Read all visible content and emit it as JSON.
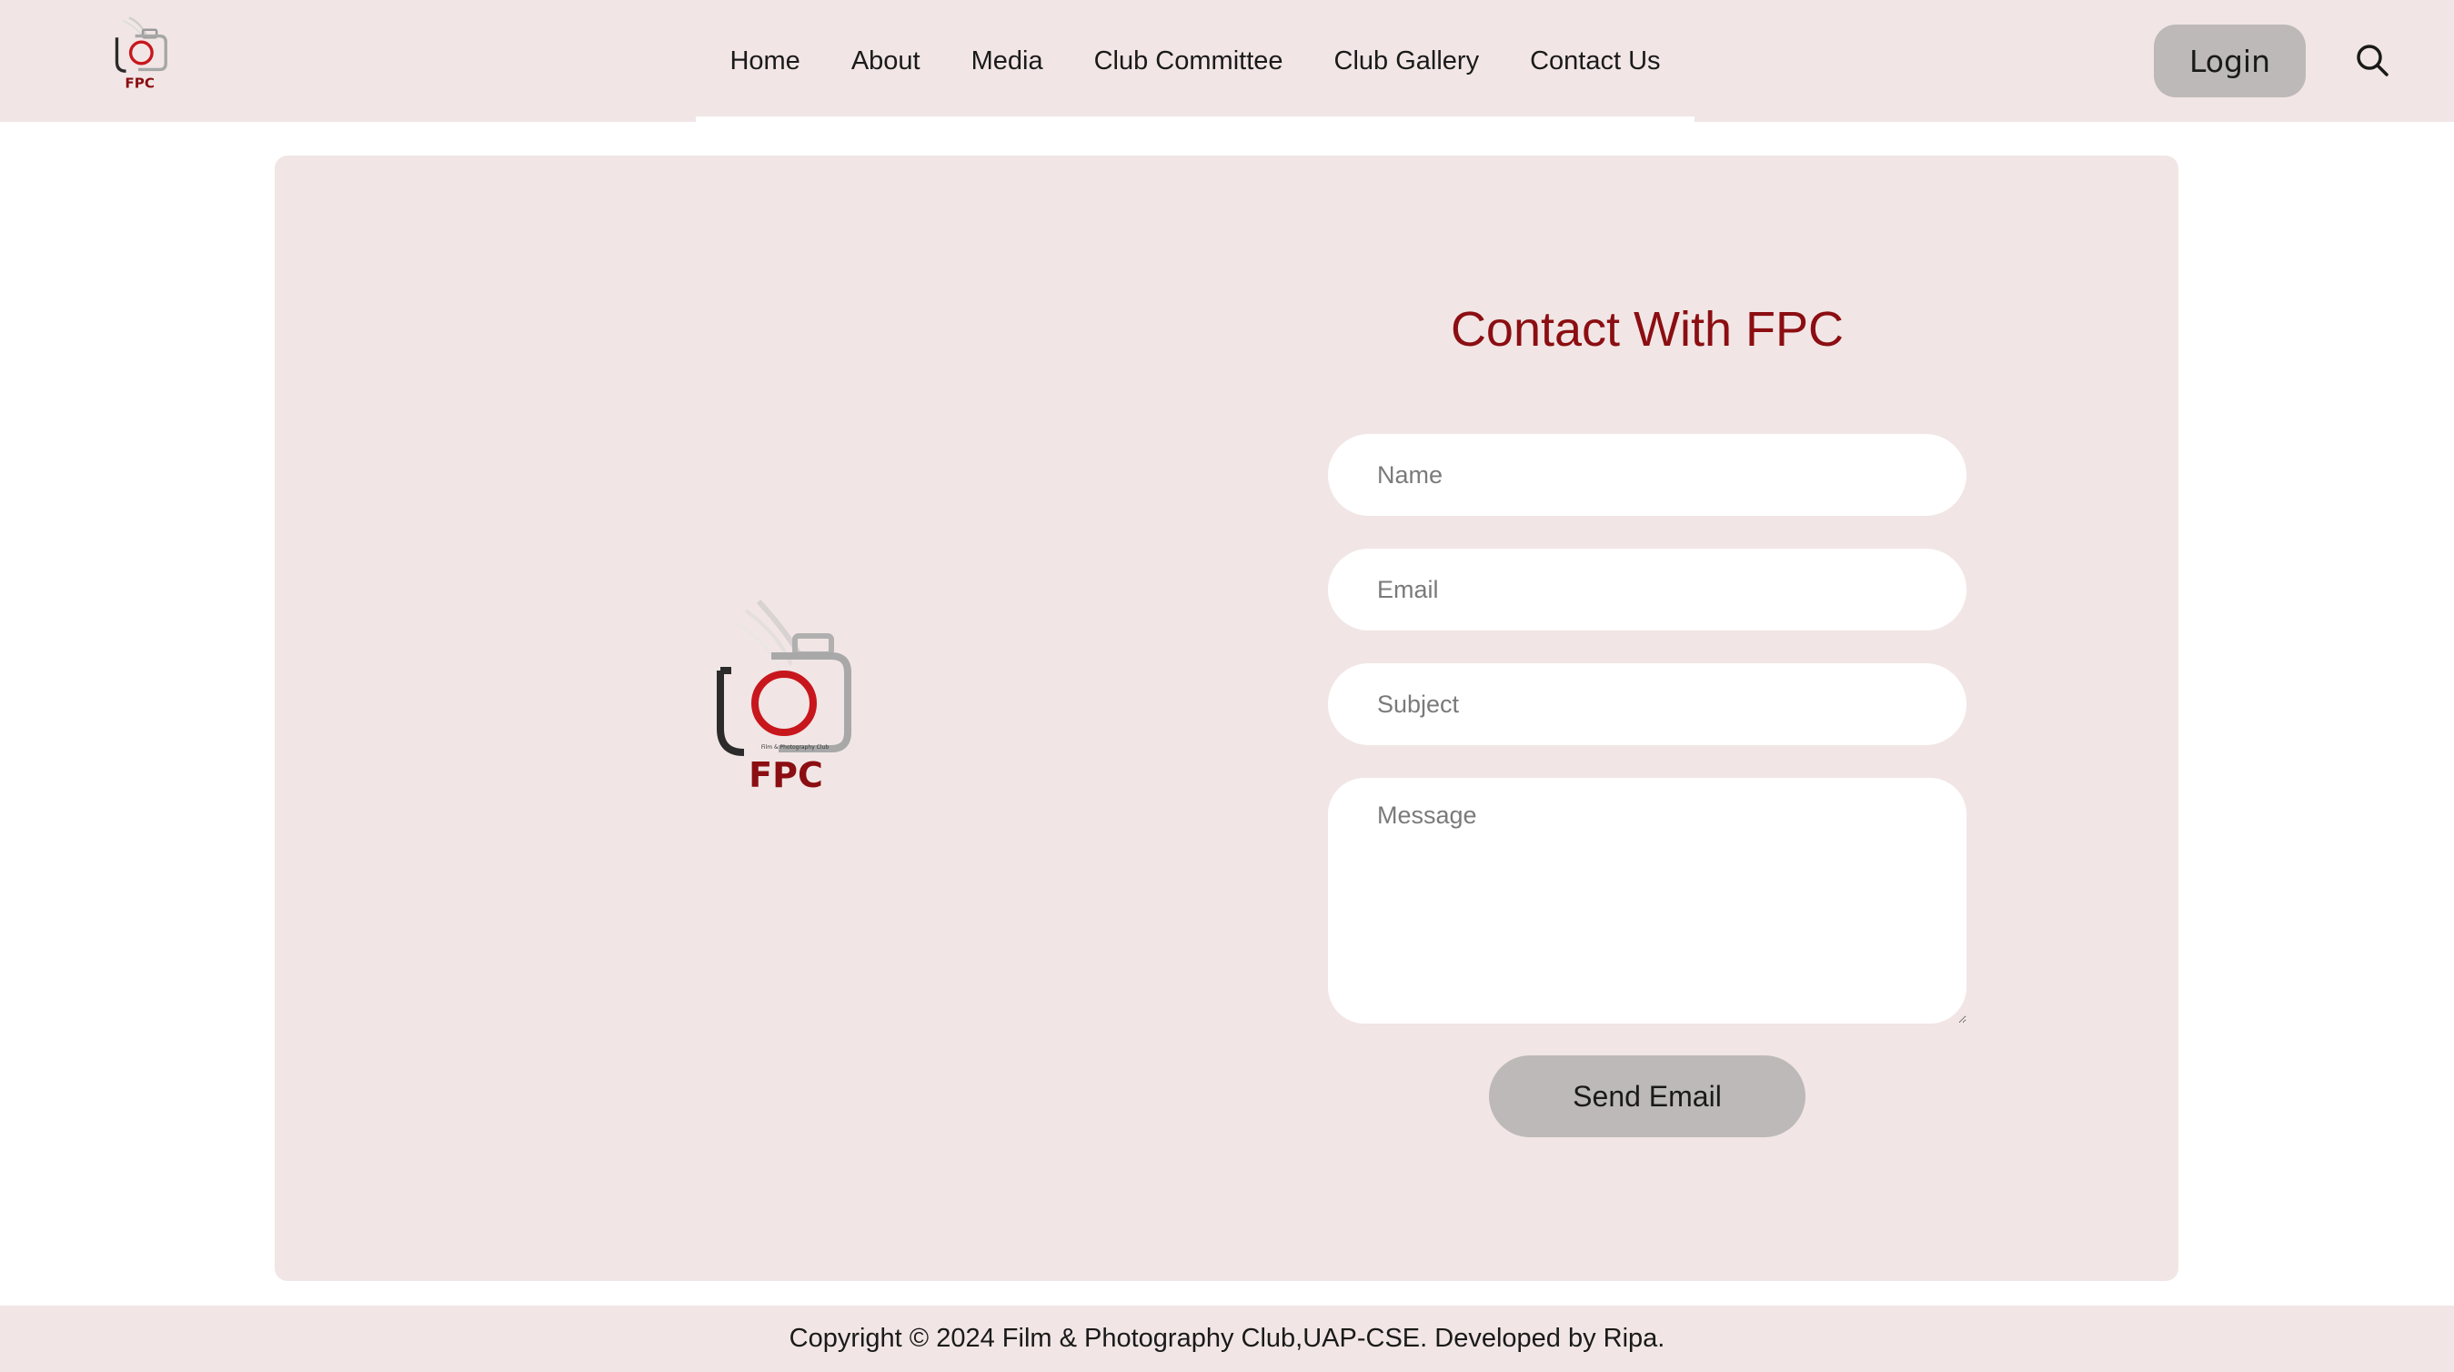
{
  "header": {
    "logo_icon": "fpc-camera-logo",
    "logo_text": "FPC",
    "nav": [
      {
        "label": "Home"
      },
      {
        "label": "About"
      },
      {
        "label": "Media"
      },
      {
        "label": "Club Committee"
      },
      {
        "label": "Club Gallery"
      },
      {
        "label": "Contact Us"
      }
    ],
    "login_label": "Login",
    "search_icon": "search-icon"
  },
  "main": {
    "logo_icon": "fpc-camera-logo",
    "logo_text": "FPC",
    "logo_caption": "Film & Photography Club",
    "title": "Contact With FPC",
    "form": {
      "name_placeholder": "Name",
      "email_placeholder": "Email",
      "subject_placeholder": "Subject",
      "message_placeholder": "Message",
      "submit_label": "Send Email"
    }
  },
  "footer": {
    "text": "Copyright © 2024 Film & Photography Club,UAP-CSE. Developed by Ripa."
  },
  "colors": {
    "accent": "#8b0e12",
    "surface": "#f1e6e5",
    "button": "#bdb9b9",
    "logo_red": "#c8161d"
  }
}
